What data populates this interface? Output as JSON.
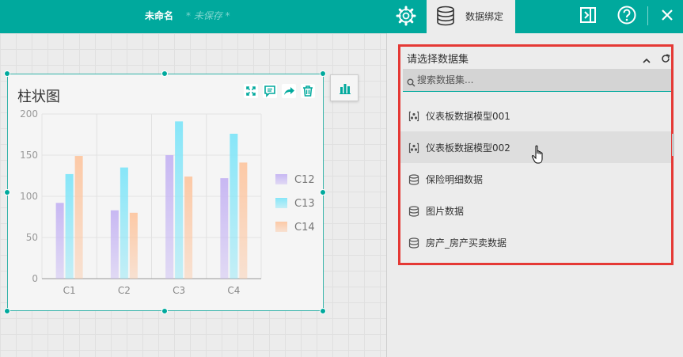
{
  "header": {
    "doc_title": "未命名",
    "doc_status": "* 未保存 *",
    "active_tab": "数据绑定",
    "brand_color": "#00a99d"
  },
  "widget": {
    "title": "柱状图"
  },
  "chart_data": {
    "type": "bar",
    "title": "柱状图",
    "categories": [
      "C1",
      "C2",
      "C3",
      "C4"
    ],
    "series": [
      {
        "name": "C12",
        "values": [
          92,
          83,
          150,
          122
        ],
        "color": "#c8b8f3"
      },
      {
        "name": "C13",
        "values": [
          127,
          135,
          191,
          176
        ],
        "color": "#87e6f8"
      },
      {
        "name": "C14",
        "values": [
          149,
          80,
          124,
          141
        ],
        "color": "#fcc9a6"
      }
    ],
    "y_ticks": [
      "0",
      "50",
      "100",
      "150",
      "200"
    ],
    "ylim": [
      0,
      200
    ],
    "grid": true,
    "legend": "right"
  },
  "dataset_selector": {
    "title": "请选择数据集",
    "search_placeholder": "搜索数据集...",
    "items": [
      {
        "label": "仪表板数据模型001",
        "icon": "model-icon"
      },
      {
        "label": "仪表板数据模型002",
        "icon": "model-icon"
      },
      {
        "label": "保险明细数据",
        "icon": "database-icon"
      },
      {
        "label": "图片数据",
        "icon": "database-icon"
      },
      {
        "label": "房产_房产买卖数据",
        "icon": "database-icon"
      }
    ]
  }
}
